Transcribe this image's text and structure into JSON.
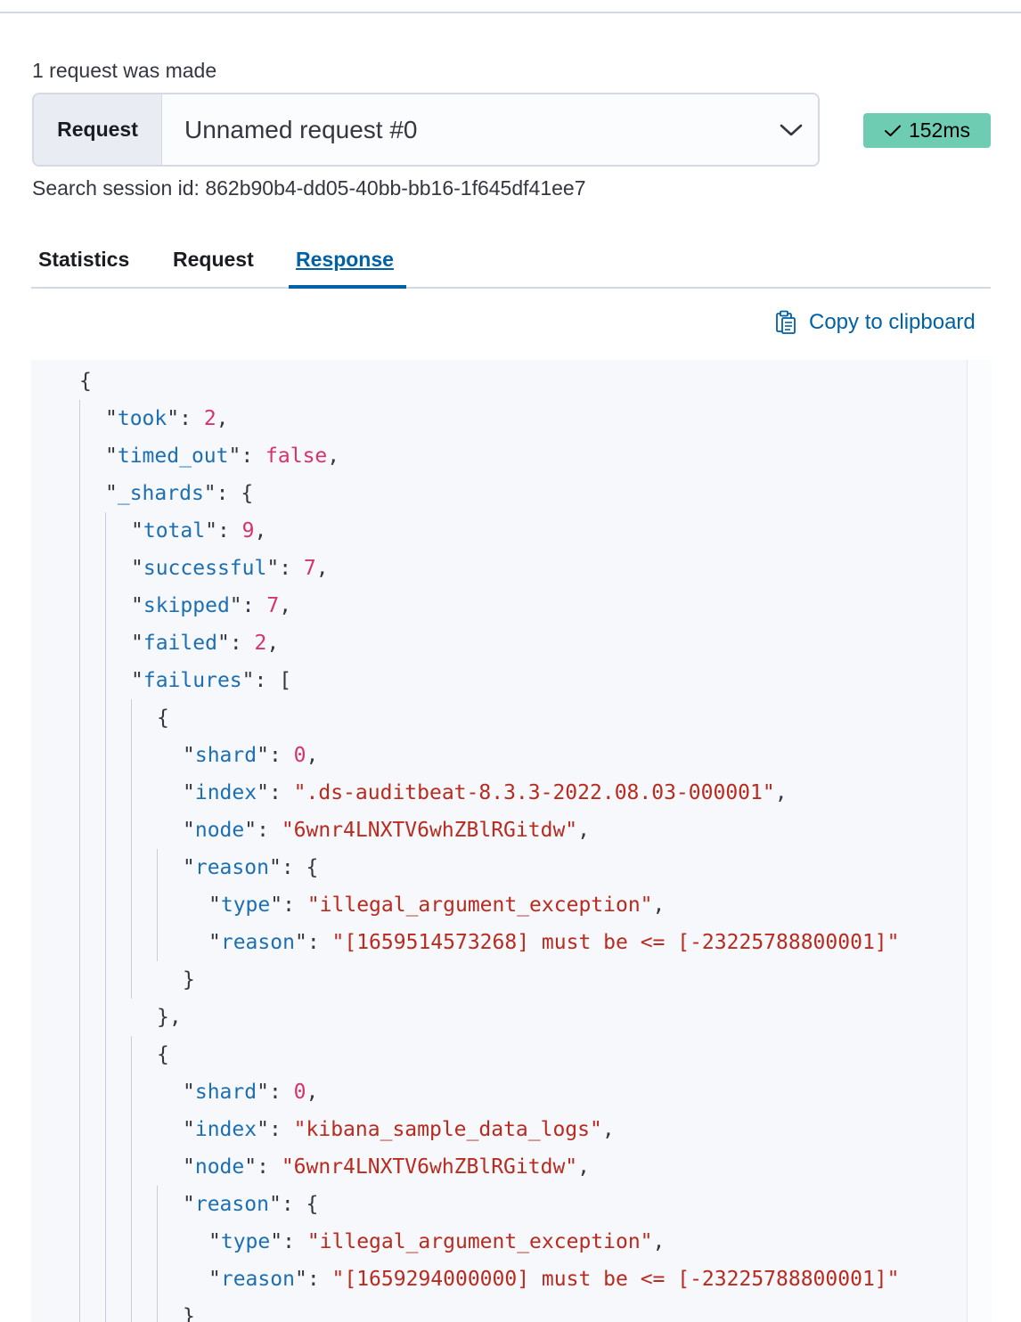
{
  "header": {
    "requests_made": "1 request was made",
    "request_label": "Request",
    "request_value": "Unnamed request #0",
    "timing": "152ms",
    "session_id": "Search session id: 862b90b4-dd05-40bb-bb16-1f645df41ee7"
  },
  "tabs": [
    {
      "label": "Statistics",
      "active": false
    },
    {
      "label": "Request",
      "active": false
    },
    {
      "label": "Response",
      "active": true
    }
  ],
  "copy_label": "Copy to clipboard",
  "colors": {
    "accent": "#0061a6",
    "badge_success": "#6dccb1",
    "json_key": "#1c6fb2",
    "json_number": "#d6336c",
    "json_string": "#b92a1f"
  },
  "code_lines": [
    [
      {
        "t": "p",
        "v": "{"
      }
    ],
    [
      {
        "t": "q",
        "v": "\""
      },
      {
        "t": "k",
        "v": "took"
      },
      {
        "t": "q",
        "v": "\""
      },
      {
        "t": "p",
        "v": ": "
      },
      {
        "t": "n",
        "v": "2"
      },
      {
        "t": "p",
        "v": ","
      }
    ],
    [
      {
        "t": "q",
        "v": "\""
      },
      {
        "t": "k",
        "v": "timed_out"
      },
      {
        "t": "q",
        "v": "\""
      },
      {
        "t": "p",
        "v": ": "
      },
      {
        "t": "n",
        "v": "false"
      },
      {
        "t": "p",
        "v": ","
      }
    ],
    [
      {
        "t": "q",
        "v": "\""
      },
      {
        "t": "k",
        "v": "_shards"
      },
      {
        "t": "q",
        "v": "\""
      },
      {
        "t": "p",
        "v": ": {"
      }
    ],
    [
      {
        "t": "q",
        "v": "\""
      },
      {
        "t": "k",
        "v": "total"
      },
      {
        "t": "q",
        "v": "\""
      },
      {
        "t": "p",
        "v": ": "
      },
      {
        "t": "n",
        "v": "9"
      },
      {
        "t": "p",
        "v": ","
      }
    ],
    [
      {
        "t": "q",
        "v": "\""
      },
      {
        "t": "k",
        "v": "successful"
      },
      {
        "t": "q",
        "v": "\""
      },
      {
        "t": "p",
        "v": ": "
      },
      {
        "t": "n",
        "v": "7"
      },
      {
        "t": "p",
        "v": ","
      }
    ],
    [
      {
        "t": "q",
        "v": "\""
      },
      {
        "t": "k",
        "v": "skipped"
      },
      {
        "t": "q",
        "v": "\""
      },
      {
        "t": "p",
        "v": ": "
      },
      {
        "t": "n",
        "v": "7"
      },
      {
        "t": "p",
        "v": ","
      }
    ],
    [
      {
        "t": "q",
        "v": "\""
      },
      {
        "t": "k",
        "v": "failed"
      },
      {
        "t": "q",
        "v": "\""
      },
      {
        "t": "p",
        "v": ": "
      },
      {
        "t": "n",
        "v": "2"
      },
      {
        "t": "p",
        "v": ","
      }
    ],
    [
      {
        "t": "q",
        "v": "\""
      },
      {
        "t": "k",
        "v": "failures"
      },
      {
        "t": "q",
        "v": "\""
      },
      {
        "t": "p",
        "v": ": ["
      }
    ],
    [
      {
        "t": "p",
        "v": "{"
      }
    ],
    [
      {
        "t": "q",
        "v": "\""
      },
      {
        "t": "k",
        "v": "shard"
      },
      {
        "t": "q",
        "v": "\""
      },
      {
        "t": "p",
        "v": ": "
      },
      {
        "t": "n",
        "v": "0"
      },
      {
        "t": "p",
        "v": ","
      }
    ],
    [
      {
        "t": "q",
        "v": "\""
      },
      {
        "t": "k",
        "v": "index"
      },
      {
        "t": "q",
        "v": "\""
      },
      {
        "t": "p",
        "v": ": "
      },
      {
        "t": "s",
        "v": "\".ds-auditbeat-8.3.3-2022.08.03-000001\""
      },
      {
        "t": "p",
        "v": ","
      }
    ],
    [
      {
        "t": "q",
        "v": "\""
      },
      {
        "t": "k",
        "v": "node"
      },
      {
        "t": "q",
        "v": "\""
      },
      {
        "t": "p",
        "v": ": "
      },
      {
        "t": "s",
        "v": "\"6wnr4LNXTV6whZBlRGitdw\""
      },
      {
        "t": "p",
        "v": ","
      }
    ],
    [
      {
        "t": "q",
        "v": "\""
      },
      {
        "t": "k",
        "v": "reason"
      },
      {
        "t": "q",
        "v": "\""
      },
      {
        "t": "p",
        "v": ": {"
      }
    ],
    [
      {
        "t": "q",
        "v": "\""
      },
      {
        "t": "k",
        "v": "type"
      },
      {
        "t": "q",
        "v": "\""
      },
      {
        "t": "p",
        "v": ": "
      },
      {
        "t": "s",
        "v": "\"illegal_argument_exception\""
      },
      {
        "t": "p",
        "v": ","
      }
    ],
    [
      {
        "t": "q",
        "v": "\""
      },
      {
        "t": "k",
        "v": "reason"
      },
      {
        "t": "q",
        "v": "\""
      },
      {
        "t": "p",
        "v": ": "
      },
      {
        "t": "s",
        "v": "\"[1659514573268] must be <= [-23225788800001]\""
      }
    ],
    [
      {
        "t": "p",
        "v": "}"
      }
    ],
    [
      {
        "t": "p",
        "v": "},"
      }
    ],
    [
      {
        "t": "p",
        "v": "{"
      }
    ],
    [
      {
        "t": "q",
        "v": "\""
      },
      {
        "t": "k",
        "v": "shard"
      },
      {
        "t": "q",
        "v": "\""
      },
      {
        "t": "p",
        "v": ": "
      },
      {
        "t": "n",
        "v": "0"
      },
      {
        "t": "p",
        "v": ","
      }
    ],
    [
      {
        "t": "q",
        "v": "\""
      },
      {
        "t": "k",
        "v": "index"
      },
      {
        "t": "q",
        "v": "\""
      },
      {
        "t": "p",
        "v": ": "
      },
      {
        "t": "s",
        "v": "\"kibana_sample_data_logs\""
      },
      {
        "t": "p",
        "v": ","
      }
    ],
    [
      {
        "t": "q",
        "v": "\""
      },
      {
        "t": "k",
        "v": "node"
      },
      {
        "t": "q",
        "v": "\""
      },
      {
        "t": "p",
        "v": ": "
      },
      {
        "t": "s",
        "v": "\"6wnr4LNXTV6whZBlRGitdw\""
      },
      {
        "t": "p",
        "v": ","
      }
    ],
    [
      {
        "t": "q",
        "v": "\""
      },
      {
        "t": "k",
        "v": "reason"
      },
      {
        "t": "q",
        "v": "\""
      },
      {
        "t": "p",
        "v": ": {"
      }
    ],
    [
      {
        "t": "q",
        "v": "\""
      },
      {
        "t": "k",
        "v": "type"
      },
      {
        "t": "q",
        "v": "\""
      },
      {
        "t": "p",
        "v": ": "
      },
      {
        "t": "s",
        "v": "\"illegal_argument_exception\""
      },
      {
        "t": "p",
        "v": ","
      }
    ],
    [
      {
        "t": "q",
        "v": "\""
      },
      {
        "t": "k",
        "v": "reason"
      },
      {
        "t": "q",
        "v": "\""
      },
      {
        "t": "p",
        "v": ": "
      },
      {
        "t": "s",
        "v": "\"[1659294000000] must be <= [-23225788800001]\""
      }
    ],
    [
      {
        "t": "p",
        "v": "}"
      }
    ]
  ]
}
